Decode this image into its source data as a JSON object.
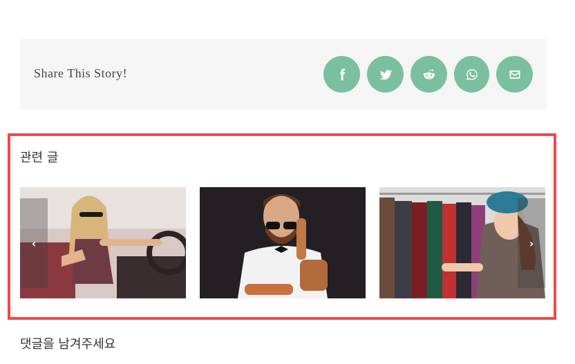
{
  "share": {
    "label": "Share This Story!",
    "buttons": [
      {
        "icon": "facebook-icon"
      },
      {
        "icon": "twitter-icon"
      },
      {
        "icon": "reddit-icon"
      },
      {
        "icon": "whatsapp-icon"
      },
      {
        "icon": "email-icon"
      }
    ],
    "button_color": "#7abf9f"
  },
  "related": {
    "title": "관련 글",
    "highlight_color": "#f24848",
    "items": [
      {
        "image": "woman-in-car-sunglasses"
      },
      {
        "image": "bearded-man-sunglasses-bowtie"
      },
      {
        "image": "woman-shopping-clothes-rack"
      }
    ],
    "prev_label": "‹",
    "next_label": "›"
  },
  "comments": {
    "title": "댓글을 남겨주세요"
  }
}
